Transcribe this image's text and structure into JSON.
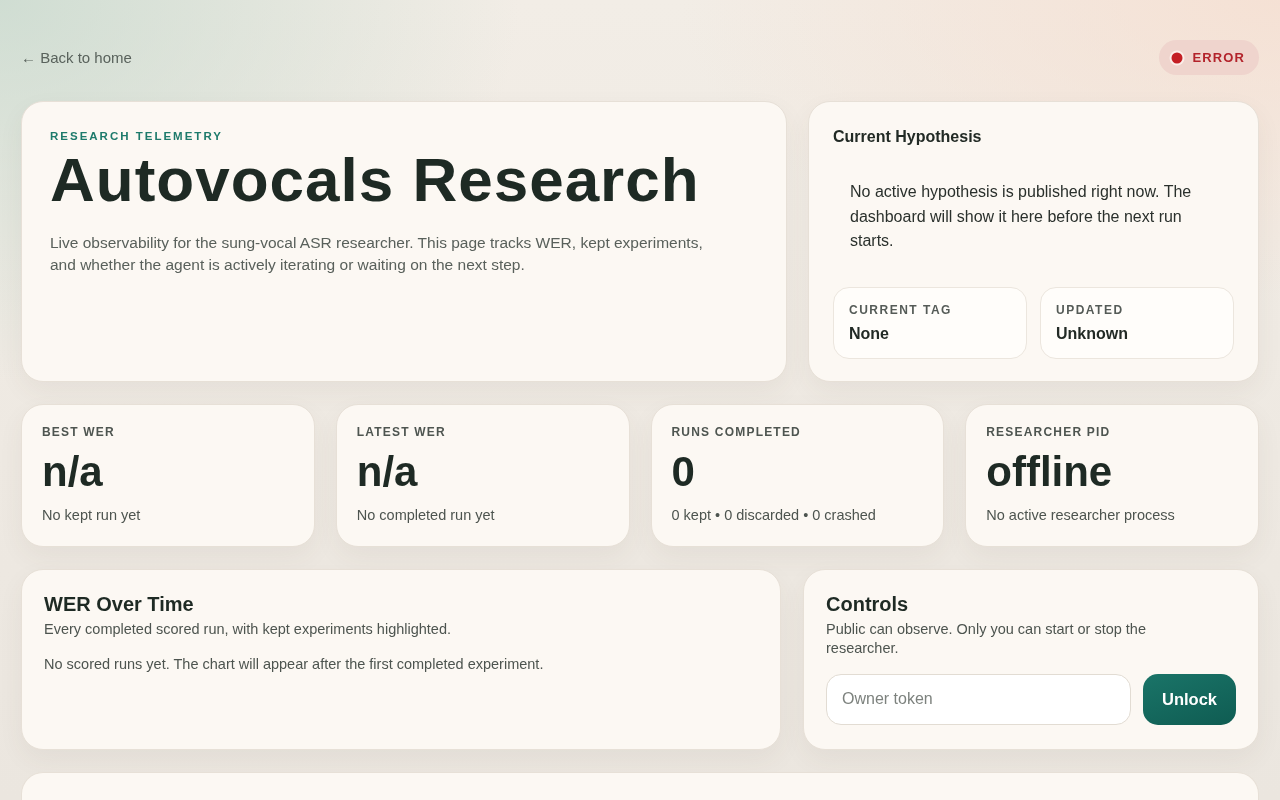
{
  "back_link": {
    "label": "← Back to home"
  },
  "status": {
    "label": "ERROR",
    "error": true
  },
  "hero": {
    "eyebrow": "RESEARCH TELEMETRY",
    "title": "Autovocals Research",
    "description": "Live observability for the sung-vocal ASR researcher. This page tracks WER, kept experiments, and whether the agent is actively iterating or waiting on the next step."
  },
  "hypothesis": {
    "title": "Current Hypothesis",
    "text": "No active hypothesis is published right now. The dashboard will show it here before the next run starts.",
    "fields": [
      {
        "label": "CURRENT TAG",
        "value": "None"
      },
      {
        "label": "UPDATED",
        "value": "Unknown"
      }
    ]
  },
  "stats": [
    {
      "label": "BEST WER",
      "value": "n/a",
      "note": "No kept run yet"
    },
    {
      "label": "LATEST WER",
      "value": "n/a",
      "note": "No completed run yet"
    },
    {
      "label": "RUNS COMPLETED",
      "value": "0",
      "note": "0 kept • 0 discarded • 0 crashed"
    },
    {
      "label": "RESEARCHER PID",
      "value": "offline",
      "note": "No active researcher process"
    }
  ],
  "wer_panel": {
    "title": "WER Over Time",
    "subtitle": "Every completed scored run, with kept experiments highlighted.",
    "empty_message": "No scored runs yet. The chart will appear after the first completed experiment."
  },
  "controls": {
    "title": "Controls",
    "text": "Public can observe. Only you can start or stop the researcher.",
    "token_field": {
      "placeholder": "Owner token"
    },
    "button": "Unlock"
  }
}
